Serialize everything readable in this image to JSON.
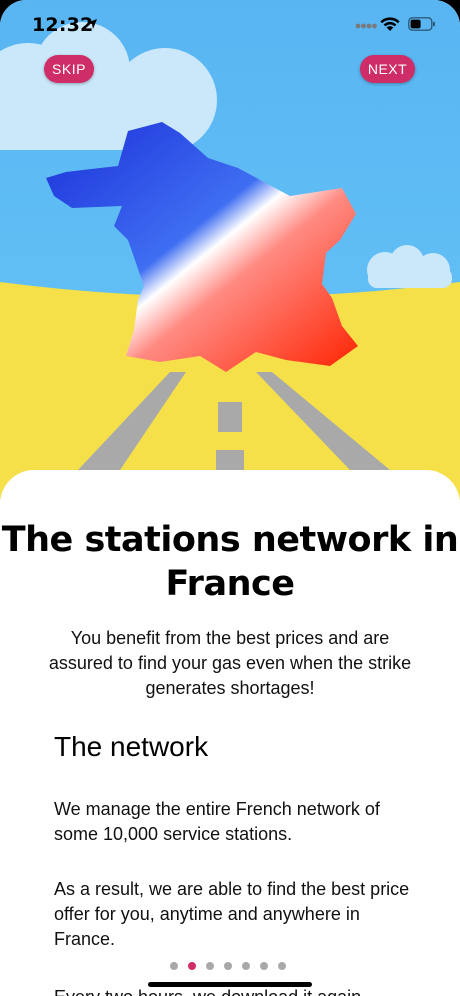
{
  "status_bar": {
    "time": "12:32"
  },
  "buttons": {
    "skip_label": "SKIP",
    "next_label": "NEXT"
  },
  "content": {
    "title": "The stations network in France",
    "subtitle": "You benefit from the best prices and are assured to find your gas even when the strike generates shortages!",
    "section_heading": "The network",
    "paragraphs": [
      "We manage the entire French network of some 10,000 service stations.",
      "As a result, we are able to find the best price offer for you, anytime and anywhere in France.",
      "Every two hours, we download it again"
    ]
  },
  "pagination": {
    "total": 7,
    "active_index": 1
  },
  "colors": {
    "accent": "#cf2d67",
    "sky": "#5bb6f0",
    "field": "#f5e04a",
    "road": "#a9a9a9",
    "flag_blue": "#1d4fe6",
    "flag_white": "#ffffff",
    "flag_red": "#ff2a1a"
  }
}
